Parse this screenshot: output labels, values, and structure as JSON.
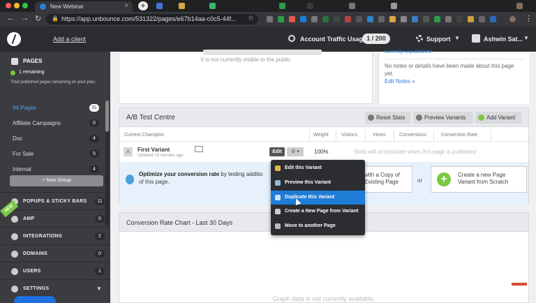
{
  "browser": {
    "tab_title": "New Webinar",
    "url": "https://app.unbounce.com/531322/pages/e67b14aa-c0c5-44f..."
  },
  "header": {
    "add_client": "Add a client",
    "traffic_label": "Account Traffic Usage",
    "traffic_value": "1 / 200",
    "support_label": "Support",
    "user_label": "Ashwin Sat..."
  },
  "sidebar": {
    "pages_title": "PAGES",
    "remaining": "1 remaining",
    "remaining_desc": "Total published pages remaining on your plan.",
    "groups": [
      {
        "label": "All Pages",
        "count": "31"
      },
      {
        "label": "Affiliate Campaigns",
        "count": "0"
      },
      {
        "label": "Doc",
        "count": "4"
      },
      {
        "label": "For Sale",
        "count": "5"
      },
      {
        "label": "Internal",
        "count": "4"
      }
    ],
    "new_group": "+ New Group",
    "nav": [
      {
        "label": "POPUPS & STICKY BARS",
        "count": "11"
      },
      {
        "label": "AMP",
        "count": "0"
      },
      {
        "label": "INTEGRATIONS",
        "count": "2"
      },
      {
        "label": "DOMAINS",
        "count": "0"
      },
      {
        "label": "USERS",
        "count": "1"
      },
      {
        "label": "SETTINGS",
        "count": ""
      }
    ],
    "new_ribbon": "NEW"
  },
  "top": {
    "not_visible": "It is not currently visible to the public.",
    "unpublished": "currently unpublished",
    "notes": "No notes or details have been made about this page yet.",
    "edit_notes": "Edit Notes »"
  },
  "ab": {
    "title": "A/B Test Centre",
    "reset_stats": "Reset Stats",
    "preview_variants": "Preview Variants",
    "add_variant": "Add Variant",
    "columns": [
      "Current Champion",
      "Weight",
      "Visitors",
      "Views",
      "Conversions",
      "Conversion Rate"
    ],
    "variant_badge": "A",
    "variant_name": "First Variant",
    "variant_updated": "Updated 13 minutes ago",
    "edit_label": "Edit",
    "gear_label": "⚙ ▾",
    "weight_value": "100%",
    "stats_msg": "Stats will accumulate when this page is published",
    "optimize_title": "Optimize your conversion rate",
    "optimize_tail": " by testing additio",
    "optimize_sub": "of this page.",
    "copy_card_1": "with a Copy of",
    "copy_card_2": "Existing Page",
    "or": "or",
    "new_card_1": "Create a new Page",
    "new_card_2": "Variant from Scratch"
  },
  "crc": {
    "title": "Conversion Rate Chart - Last 30 Days",
    "empty": "Graph data is not currently available."
  },
  "dropdown": [
    "Edit this Variant",
    "Preview this Variant",
    "Duplicate this Variant",
    "Create a New Page from Variant",
    "Move to another Page"
  ]
}
